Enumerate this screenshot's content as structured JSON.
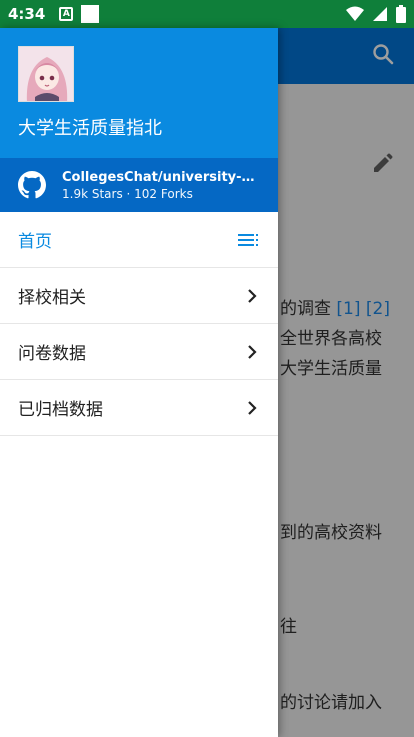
{
  "status_bar": {
    "time": "4:34",
    "notification_a": "A"
  },
  "background_page": {
    "lines": [
      {
        "text": "的调查",
        "refs": [
          "[1]",
          "[2]"
        ]
      },
      {
        "text": "全世界各高校",
        "refs": []
      },
      {
        "text": "大学生活质量",
        "refs": []
      },
      {
        "text": "到的高校资料",
        "refs": []
      },
      {
        "text": "往",
        "refs": []
      },
      {
        "text": "的讨论请加入",
        "refs": []
      }
    ]
  },
  "drawer": {
    "site_title": "大学生活质量指北",
    "repo": {
      "name": "CollegesChat/university-in...",
      "stats": "1.9k Stars · 102 Forks"
    },
    "nav": [
      {
        "label": "首页",
        "active": true,
        "icon": "toc-icon"
      },
      {
        "label": "择校相关",
        "active": false,
        "icon": "chevron-right-icon"
      },
      {
        "label": "问卷数据",
        "active": false,
        "icon": "chevron-right-icon"
      },
      {
        "label": "已归档数据",
        "active": false,
        "icon": "chevron-right-icon"
      }
    ]
  },
  "colors": {
    "status_bar": "#0f7f3a",
    "header_blue": "#0a8ae0",
    "repo_blue": "#0568c4",
    "accent": "#0a8ae0"
  }
}
